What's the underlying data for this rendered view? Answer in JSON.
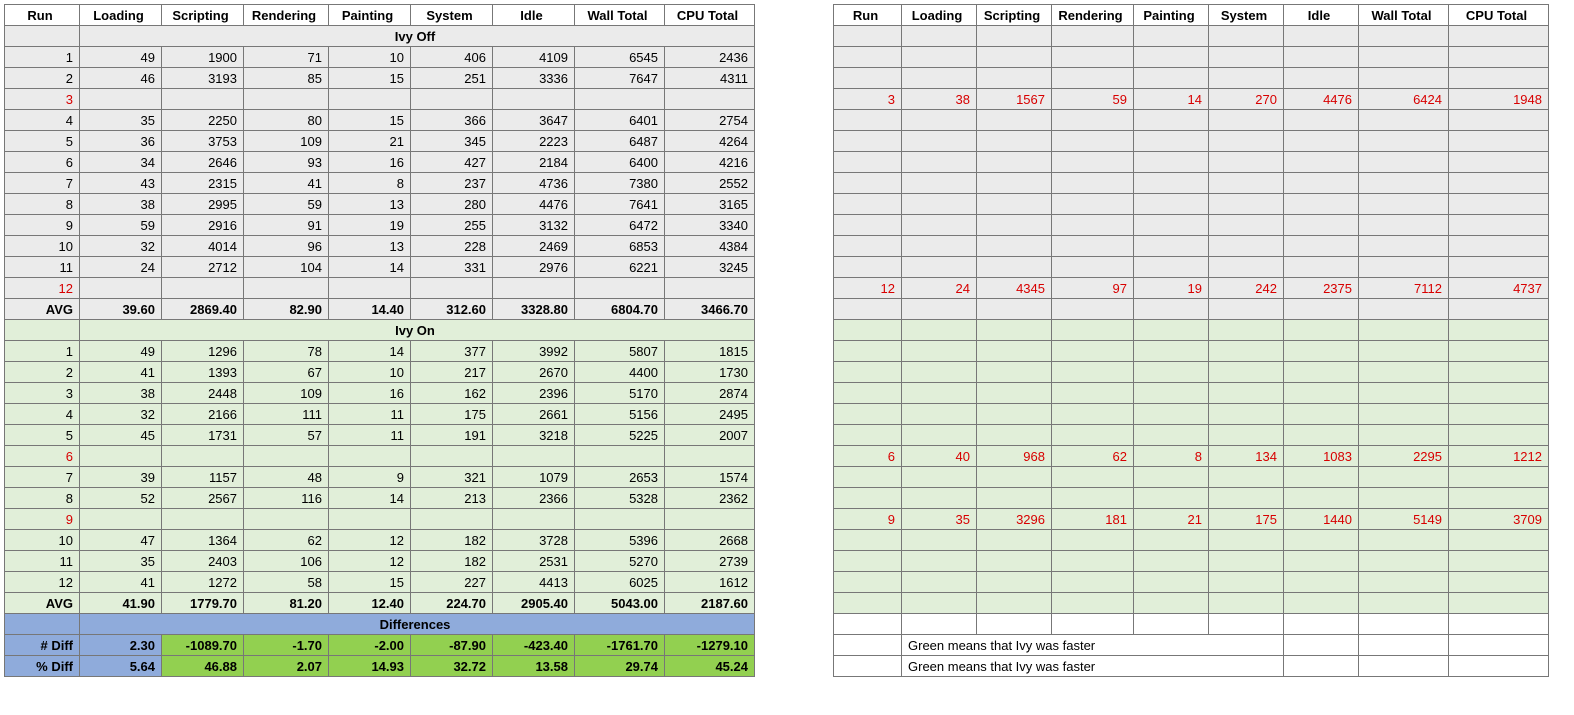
{
  "headers": [
    "Run",
    "Loading",
    "Scripting",
    "Rendering",
    "Painting",
    "System",
    "Idle",
    "Wall Total",
    "CPU Total"
  ],
  "sections": {
    "ivyOff": "Ivy Off",
    "ivyOn": "Ivy On",
    "diff": "Differences"
  },
  "ivyOff": {
    "rows": [
      {
        "run": "1",
        "v": [
          "49",
          "1900",
          "71",
          "10",
          "406",
          "4109",
          "6545",
          "2436"
        ]
      },
      {
        "run": "2",
        "v": [
          "46",
          "3193",
          "85",
          "15",
          "251",
          "3336",
          "7647",
          "4311"
        ]
      },
      {
        "run": "3",
        "red": true,
        "v": [
          "",
          "",
          "",
          "",
          "",
          "",
          "",
          ""
        ]
      },
      {
        "run": "4",
        "v": [
          "35",
          "2250",
          "80",
          "15",
          "366",
          "3647",
          "6401",
          "2754"
        ]
      },
      {
        "run": "5",
        "v": [
          "36",
          "3753",
          "109",
          "21",
          "345",
          "2223",
          "6487",
          "4264"
        ]
      },
      {
        "run": "6",
        "v": [
          "34",
          "2646",
          "93",
          "16",
          "427",
          "2184",
          "6400",
          "4216"
        ]
      },
      {
        "run": "7",
        "v": [
          "43",
          "2315",
          "41",
          "8",
          "237",
          "4736",
          "7380",
          "2552"
        ]
      },
      {
        "run": "8",
        "v": [
          "38",
          "2995",
          "59",
          "13",
          "280",
          "4476",
          "7641",
          "3165"
        ]
      },
      {
        "run": "9",
        "v": [
          "59",
          "2916",
          "91",
          "19",
          "255",
          "3132",
          "6472",
          "3340"
        ]
      },
      {
        "run": "10",
        "v": [
          "32",
          "4014",
          "96",
          "13",
          "228",
          "2469",
          "6853",
          "4384"
        ]
      },
      {
        "run": "11",
        "v": [
          "24",
          "2712",
          "104",
          "14",
          "331",
          "2976",
          "6221",
          "3245"
        ]
      },
      {
        "run": "12",
        "red": true,
        "v": [
          "",
          "",
          "",
          "",
          "",
          "",
          "",
          ""
        ]
      }
    ],
    "avgLabel": "AVG",
    "avg": [
      "39.60",
      "2869.40",
      "82.90",
      "14.40",
      "312.60",
      "3328.80",
      "6804.70",
      "3466.70"
    ]
  },
  "ivyOn": {
    "rows": [
      {
        "run": "1",
        "v": [
          "49",
          "1296",
          "78",
          "14",
          "377",
          "3992",
          "5807",
          "1815"
        ]
      },
      {
        "run": "2",
        "v": [
          "41",
          "1393",
          "67",
          "10",
          "217",
          "2670",
          "4400",
          "1730"
        ]
      },
      {
        "run": "3",
        "v": [
          "38",
          "2448",
          "109",
          "16",
          "162",
          "2396",
          "5170",
          "2874"
        ]
      },
      {
        "run": "4",
        "v": [
          "32",
          "2166",
          "111",
          "11",
          "175",
          "2661",
          "5156",
          "2495"
        ]
      },
      {
        "run": "5",
        "v": [
          "45",
          "1731",
          "57",
          "11",
          "191",
          "3218",
          "5225",
          "2007"
        ]
      },
      {
        "run": "6",
        "red": true,
        "v": [
          "",
          "",
          "",
          "",
          "",
          "",
          "",
          ""
        ]
      },
      {
        "run": "7",
        "v": [
          "39",
          "1157",
          "48",
          "9",
          "321",
          "1079",
          "2653",
          "1574"
        ]
      },
      {
        "run": "8",
        "v": [
          "52",
          "2567",
          "116",
          "14",
          "213",
          "2366",
          "5328",
          "2362"
        ]
      },
      {
        "run": "9",
        "red": true,
        "v": [
          "",
          "",
          "",
          "",
          "",
          "",
          "",
          ""
        ]
      },
      {
        "run": "10",
        "v": [
          "47",
          "1364",
          "62",
          "12",
          "182",
          "3728",
          "5396",
          "2668"
        ]
      },
      {
        "run": "11",
        "v": [
          "35",
          "2403",
          "106",
          "12",
          "182",
          "2531",
          "5270",
          "2739"
        ]
      },
      {
        "run": "12",
        "v": [
          "41",
          "1272",
          "58",
          "15",
          "227",
          "4413",
          "6025",
          "1612"
        ]
      }
    ],
    "avgLabel": "AVG",
    "avg": [
      "41.90",
      "1779.70",
      "81.20",
      "12.40",
      "224.70",
      "2905.40",
      "5043.00",
      "2187.60"
    ]
  },
  "diff": {
    "numLabel": "# Diff",
    "pctLabel": "% Diff",
    "num": [
      {
        "v": "2.30",
        "g": false
      },
      {
        "v": "-1089.70",
        "g": true
      },
      {
        "v": "-1.70",
        "g": true
      },
      {
        "v": "-2.00",
        "g": true
      },
      {
        "v": "-87.90",
        "g": true
      },
      {
        "v": "-423.40",
        "g": true
      },
      {
        "v": "-1761.70",
        "g": true
      },
      {
        "v": "-1279.10",
        "g": true
      }
    ],
    "pct": [
      {
        "v": "5.64",
        "g": false
      },
      {
        "v": "46.88",
        "g": true
      },
      {
        "v": "2.07",
        "g": true
      },
      {
        "v": "14.93",
        "g": true
      },
      {
        "v": "32.72",
        "g": true
      },
      {
        "v": "13.58",
        "g": true
      },
      {
        "v": "29.74",
        "g": true
      },
      {
        "v": "45.24",
        "g": true
      }
    ]
  },
  "right": {
    "rows": [
      {
        "cls": "r-empty",
        "v": [
          "",
          "",
          "",
          "",
          "",
          "",
          "",
          "",
          ""
        ]
      },
      {
        "cls": "r-empty",
        "v": [
          "",
          "",
          "",
          "",
          "",
          "",
          "",
          "",
          ""
        ]
      },
      {
        "cls": "r-empty",
        "v": [
          "",
          "",
          "",
          "",
          "",
          "",
          "",
          "",
          ""
        ]
      },
      {
        "cls": "r-empty",
        "red": true,
        "v": [
          "3",
          "38",
          "1567",
          "59",
          "14",
          "270",
          "4476",
          "6424",
          "1948"
        ]
      },
      {
        "cls": "r-empty",
        "v": [
          "",
          "",
          "",
          "",
          "",
          "",
          "",
          "",
          ""
        ]
      },
      {
        "cls": "r-empty",
        "v": [
          "",
          "",
          "",
          "",
          "",
          "",
          "",
          "",
          ""
        ]
      },
      {
        "cls": "r-empty",
        "v": [
          "",
          "",
          "",
          "",
          "",
          "",
          "",
          "",
          ""
        ]
      },
      {
        "cls": "r-empty",
        "v": [
          "",
          "",
          "",
          "",
          "",
          "",
          "",
          "",
          ""
        ]
      },
      {
        "cls": "r-empty",
        "v": [
          "",
          "",
          "",
          "",
          "",
          "",
          "",
          "",
          ""
        ]
      },
      {
        "cls": "r-empty",
        "v": [
          "",
          "",
          "",
          "",
          "",
          "",
          "",
          "",
          ""
        ]
      },
      {
        "cls": "r-empty",
        "v": [
          "",
          "",
          "",
          "",
          "",
          "",
          "",
          "",
          ""
        ]
      },
      {
        "cls": "r-empty",
        "v": [
          "",
          "",
          "",
          "",
          "",
          "",
          "",
          "",
          ""
        ]
      },
      {
        "cls": "r-empty",
        "red": true,
        "v": [
          "12",
          "24",
          "4345",
          "97",
          "19",
          "242",
          "2375",
          "7112",
          "4737"
        ]
      },
      {
        "cls": "r-empty",
        "v": [
          "",
          "",
          "",
          "",
          "",
          "",
          "",
          "",
          ""
        ]
      },
      {
        "cls": "r-green",
        "v": [
          "",
          "",
          "",
          "",
          "",
          "",
          "",
          "",
          ""
        ]
      },
      {
        "cls": "r-green",
        "v": [
          "",
          "",
          "",
          "",
          "",
          "",
          "",
          "",
          ""
        ]
      },
      {
        "cls": "r-green",
        "v": [
          "",
          "",
          "",
          "",
          "",
          "",
          "",
          "",
          ""
        ]
      },
      {
        "cls": "r-green",
        "v": [
          "",
          "",
          "",
          "",
          "",
          "",
          "",
          "",
          ""
        ]
      },
      {
        "cls": "r-green",
        "v": [
          "",
          "",
          "",
          "",
          "",
          "",
          "",
          "",
          ""
        ]
      },
      {
        "cls": "r-green",
        "v": [
          "",
          "",
          "",
          "",
          "",
          "",
          "",
          "",
          ""
        ]
      },
      {
        "cls": "r-green",
        "red": true,
        "v": [
          "6",
          "40",
          "968",
          "62",
          "8",
          "134",
          "1083",
          "2295",
          "1212"
        ]
      },
      {
        "cls": "r-green",
        "v": [
          "",
          "",
          "",
          "",
          "",
          "",
          "",
          "",
          ""
        ]
      },
      {
        "cls": "r-green",
        "v": [
          "",
          "",
          "",
          "",
          "",
          "",
          "",
          "",
          ""
        ]
      },
      {
        "cls": "r-green",
        "red": true,
        "v": [
          "9",
          "35",
          "3296",
          "181",
          "21",
          "175",
          "1440",
          "5149",
          "3709"
        ]
      },
      {
        "cls": "r-green",
        "v": [
          "",
          "",
          "",
          "",
          "",
          "",
          "",
          "",
          ""
        ]
      },
      {
        "cls": "r-green",
        "v": [
          "",
          "",
          "",
          "",
          "",
          "",
          "",
          "",
          ""
        ]
      },
      {
        "cls": "r-green",
        "v": [
          "",
          "",
          "",
          "",
          "",
          "",
          "",
          "",
          ""
        ]
      },
      {
        "cls": "r-green",
        "v": [
          "",
          "",
          "",
          "",
          "",
          "",
          "",
          "",
          ""
        ]
      },
      {
        "cls": "r-white",
        "v": [
          "",
          "",
          "",
          "",
          "",
          "",
          "",
          "",
          ""
        ]
      }
    ],
    "note": "Green means that Ivy was faster"
  },
  "colWidthsLeft": [
    75,
    82,
    82,
    85,
    82,
    82,
    82,
    90,
    90
  ],
  "colWidthsRight": [
    68,
    75,
    75,
    82,
    75,
    75,
    75,
    90,
    100
  ]
}
